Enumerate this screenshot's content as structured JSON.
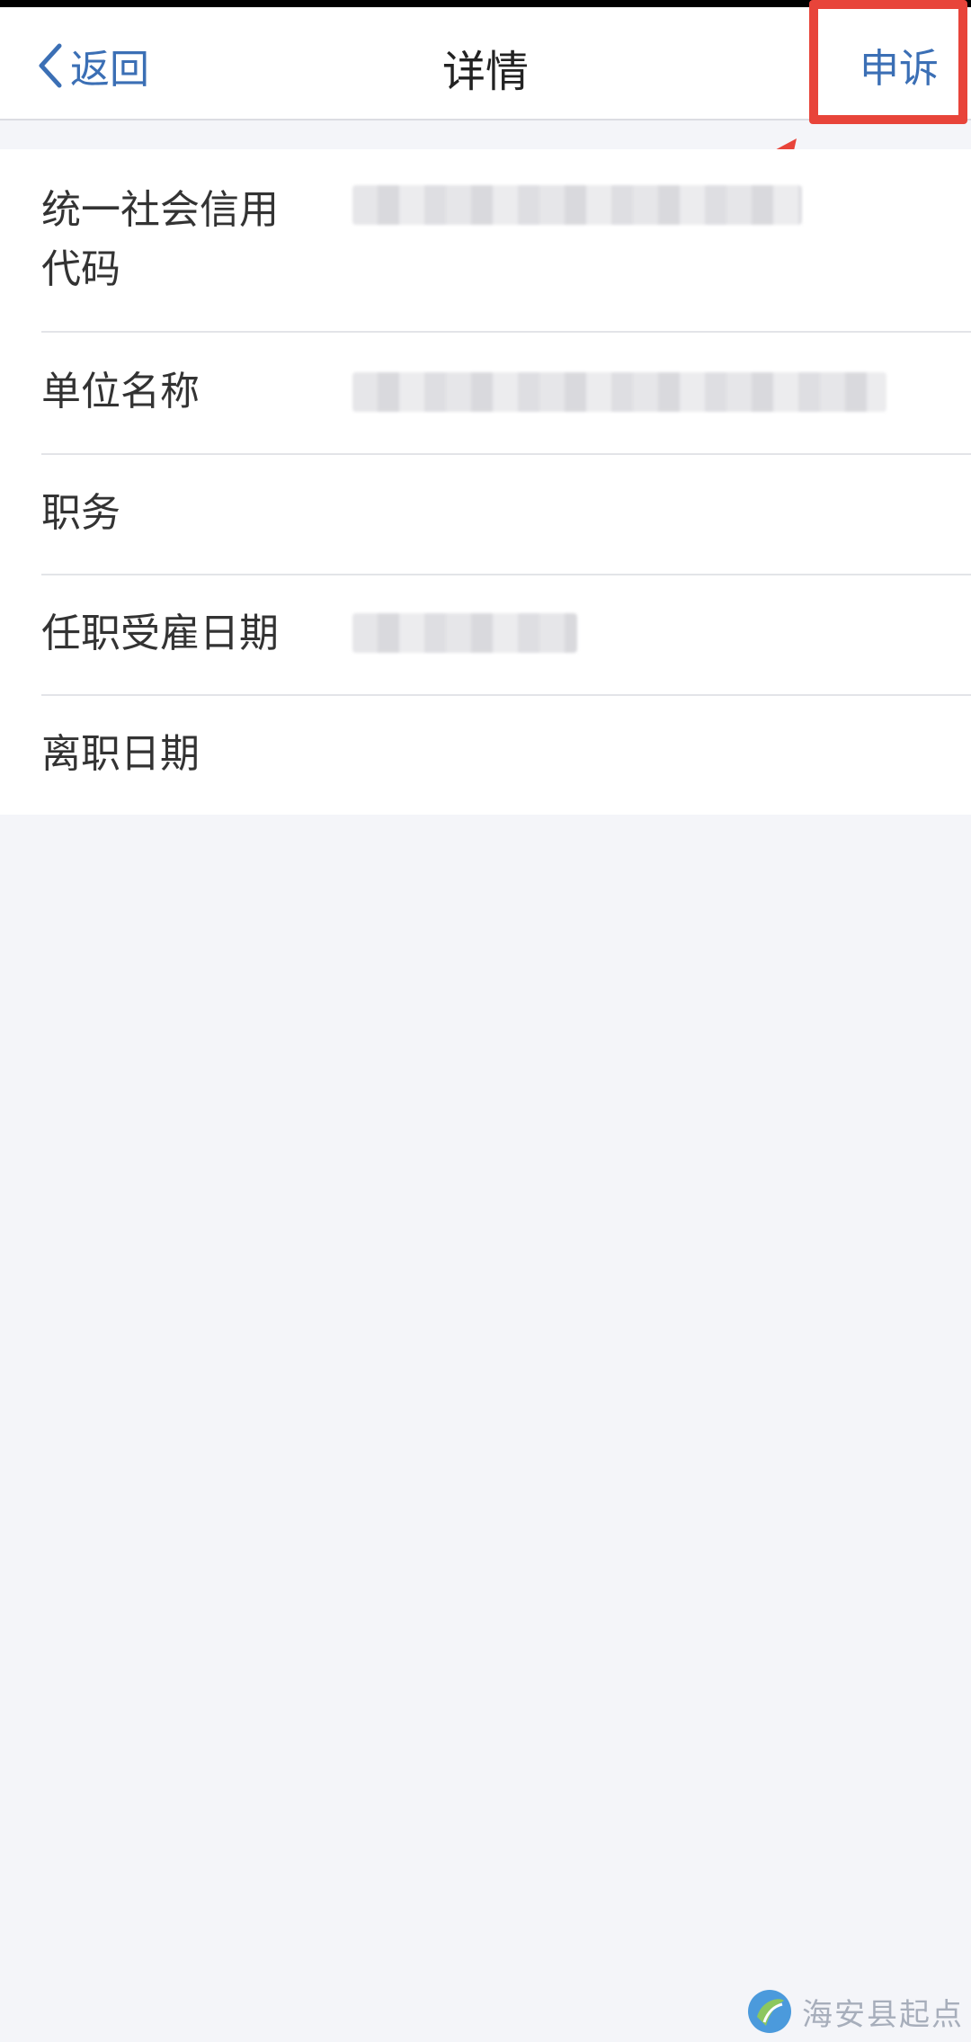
{
  "navbar": {
    "back_label": "返回",
    "title": "详情",
    "appeal_label": "申诉"
  },
  "details": {
    "rows": [
      {
        "label": "统一社会信用\n代码"
      },
      {
        "label": "单位名称"
      },
      {
        "label": "职务"
      },
      {
        "label": "任职受雇日期"
      },
      {
        "label": "离职日期"
      }
    ]
  },
  "colors": {
    "accent": "#3b6fb5",
    "highlight": "#e8443a",
    "background": "#f4f5f9"
  },
  "watermark": {
    "text": "海安县起点"
  }
}
